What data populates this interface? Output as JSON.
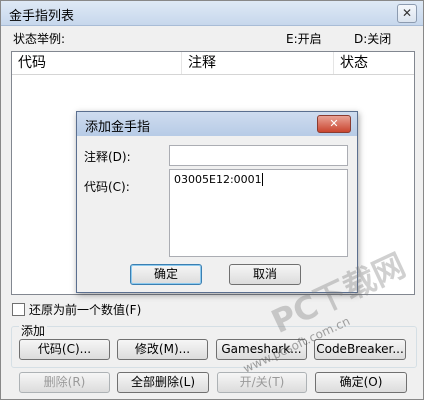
{
  "window": {
    "title": "金手指列表",
    "close_glyph": "✕"
  },
  "status_row": {
    "label": "状态举例:",
    "e_label": "E:开启",
    "d_label": "D:关闭"
  },
  "list": {
    "columns": [
      "代码",
      "注释",
      "状态"
    ]
  },
  "restore_checkbox": {
    "label": "还原为前一个数值(F)",
    "checked": false
  },
  "add_group": {
    "label": "添加",
    "buttons": [
      "代码(C)...",
      "修改(M)...",
      "Gameshark...",
      "CodeBreaker..."
    ]
  },
  "bottom_buttons": {
    "delete": "删除(R)",
    "delete_all": "全部删除(L)",
    "toggle": "开/关(T)",
    "ok": "确定(O)"
  },
  "dialog": {
    "title": "添加金手指",
    "close_glyph": "✕",
    "comment_label": "注释(D):",
    "comment_value": "",
    "code_label": "代码(C):",
    "code_value": "03005E12:0001",
    "ok": "确定",
    "cancel": "取消"
  },
  "watermark": {
    "main": "PC下载网",
    "url": "www.pcsoft.com.cn"
  }
}
